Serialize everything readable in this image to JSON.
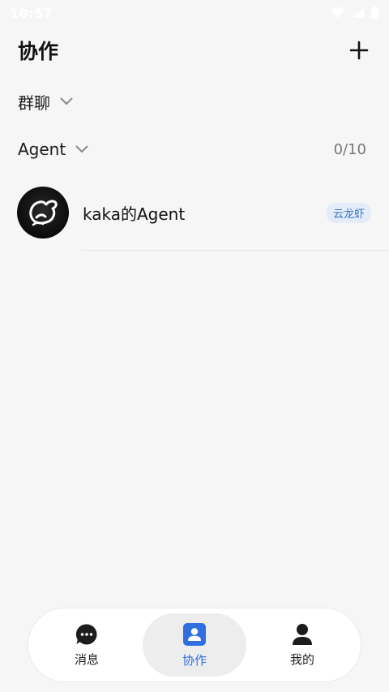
{
  "status_bar": {
    "time": "10:57"
  },
  "header": {
    "title": "协作",
    "add_icon": "plus-icon"
  },
  "sections": {
    "group_chat": {
      "label": "群聊"
    },
    "agent": {
      "label": "Agent",
      "count": "0/10"
    }
  },
  "agents": [
    {
      "name": "kaka的Agent",
      "badge": "云龙虾"
    }
  ],
  "bottom_nav": {
    "items": [
      {
        "label": "消息",
        "icon": "chat-bubble-icon"
      },
      {
        "label": "协作",
        "icon": "contact-card-icon",
        "active": true
      },
      {
        "label": "我的",
        "icon": "person-icon"
      }
    ]
  },
  "colors": {
    "accent": "#2f6fe0",
    "background": "#f6f6f6",
    "badge_bg": "#e3ecf8",
    "badge_text": "#3d74c7"
  }
}
